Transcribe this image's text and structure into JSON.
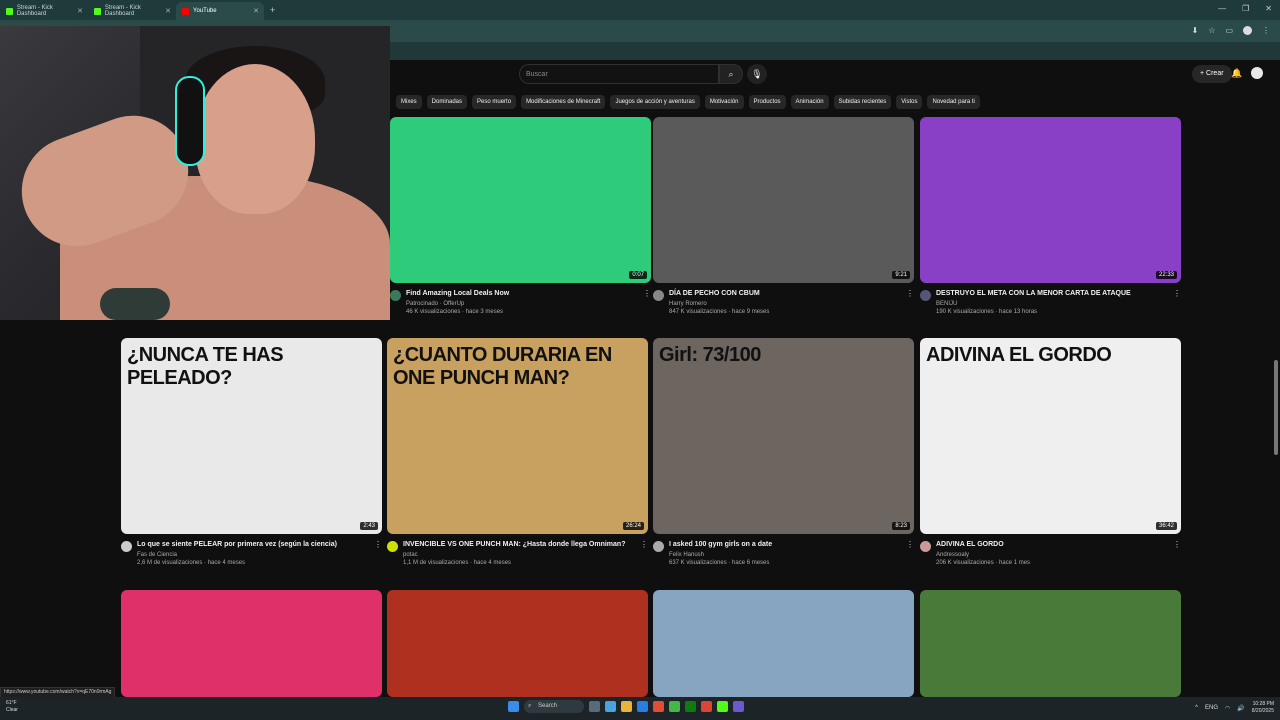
{
  "browser": {
    "tabs": [
      {
        "label": "Stream - Kick Dashboard",
        "favicon_color": "#53fc18"
      },
      {
        "label": "Stream - Kick Dashboard",
        "favicon_color": "#53fc18"
      },
      {
        "label": "YouTube",
        "favicon_color": "#ff0000",
        "active": true
      }
    ],
    "new_tab": "+",
    "window_controls": [
      "—",
      "❐",
      "✕"
    ]
  },
  "youtube": {
    "search_placeholder": "Buscar",
    "create_label": "Crear",
    "chips": [
      "Mixes",
      "Dominadas",
      "Peso muerto",
      "Modificaciones de Minecraft",
      "Juegos de acción y aventuras",
      "Motivación",
      "Productos",
      "Animación",
      "Subidas recientes",
      "Vistos",
      "Novedad para ti"
    ],
    "videos_row1": [
      {
        "title": "Find Amazing Local Deals Now",
        "channel": "Patrocinado · OfferUp",
        "stats": "46 K visualizaciones · hace 3 meses",
        "duration": "0:07",
        "avatar": "#3a7a5a"
      },
      {
        "title": "DÍA DE PECHO CON CBUM",
        "channel": "Harry Romero",
        "stats": "847 K visualizaciones · hace 9 meses",
        "duration": "9:21",
        "avatar": "#888"
      },
      {
        "title": "DESTRUYO EL META CON LA MENOR CARTA DE ATAQUE",
        "channel": "BENIJU",
        "stats": "190 K visualizaciones · hace 13 horas",
        "duration": "22:33",
        "avatar": "#557"
      }
    ],
    "videos_row2": [
      {
        "title": "Lo que se siente PELEAR por primera vez (según la ciencia)",
        "channel": "Fas de Ciencia",
        "stats": "2,6 M de visualizaciones · hace 4 meses",
        "duration": "2:43",
        "avatar": "#ccc",
        "thumb_text": "¿NUNCA TE HAS PELEADO?"
      },
      {
        "title": "INVENCIBLE VS ONE PUNCH MAN: ¿Hasta donde llega Omniman?",
        "channel": "potac",
        "stats": "1,1 M de visualizaciones · hace 4 meses",
        "duration": "26:24",
        "avatar": "#cde000",
        "thumb_text": "¿CUANTO DURARIA EN ONE PUNCH MAN?"
      },
      {
        "title": "I asked 100 gym girls on a date",
        "channel": "Felix Hanush",
        "stats": "637 K visualizaciones · hace 6 meses",
        "duration": "8:23",
        "avatar": "#aaa",
        "thumb_text": "Girl: 73/100"
      },
      {
        "title": "ADIVINA EL GORDO",
        "channel": "Andressoaly",
        "stats": "206 K visualizaciones · hace 1 mes",
        "duration": "36:42",
        "avatar": "#c99",
        "thumb_text": "ADIVINA EL GORDO"
      }
    ],
    "row2_thumb_colors": [
      "#e9e9e9",
      "#c8a060",
      "#6d6560",
      "#efefef"
    ],
    "row3_thumb_colors": [
      "#e0306a",
      "#b03020",
      "#87a5c0",
      "#4a7a3a"
    ],
    "row1_thumb_colors": [
      "#2ecc7a",
      "#5a5a5a",
      "#8a3fc7"
    ]
  },
  "status_url": "https://www.youtube.com/watch?v=qE70n0rmAg",
  "taskbar": {
    "weather_temp": "61°F",
    "weather_desc": "Clear",
    "search_label": "Search",
    "lang": "ENG",
    "time": "10:28 PM",
    "date": "8/20/2025"
  }
}
